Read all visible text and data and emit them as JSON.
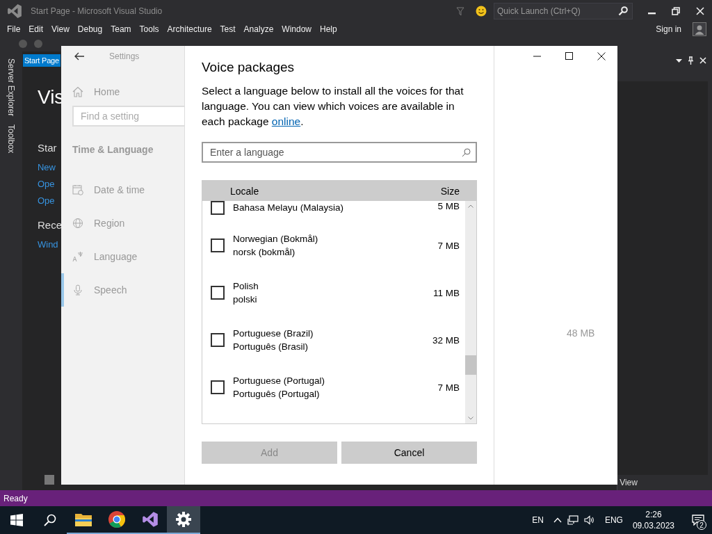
{
  "vs": {
    "title": "Start Page - Microsoft Visual Studio",
    "quick_launch": {
      "placeholder": "Quick Launch (Ctrl+Q)"
    },
    "menu": [
      "File",
      "Edit",
      "View",
      "Debug",
      "Team",
      "Tools",
      "Architecture",
      "Test",
      "Analyze",
      "Window",
      "Help"
    ],
    "sign_in": "Sign in",
    "side_tabs": [
      "Server Explorer",
      "Toolbox"
    ],
    "doc_tab": "Start Page",
    "start_page": {
      "heading": "Vis",
      "sections": [
        {
          "title": "Star",
          "links": [
            "New",
            "Ope",
            "Ope"
          ]
        },
        {
          "title": "Rece",
          "links": [
            "Wind"
          ]
        }
      ]
    },
    "panel_footer": "View",
    "status": "Ready"
  },
  "settings": {
    "title": "Settings",
    "home": "Home",
    "search": {
      "placeholder": "Find a setting"
    },
    "category": "Time & Language",
    "nav": [
      {
        "label": "Date & time",
        "kind": "calendar",
        "selected": false
      },
      {
        "label": "Region",
        "kind": "globe",
        "selected": false
      },
      {
        "label": "Language",
        "kind": "language",
        "selected": false
      },
      {
        "label": "Speech",
        "kind": "microphone",
        "selected": true
      }
    ],
    "background_size": "48 MB"
  },
  "dialog": {
    "title": "Voice packages",
    "description": "Select a language below to install all the voices for that language. You can view which voices are available in each package ",
    "link": "online",
    "after_link": ".",
    "search": {
      "placeholder": "Enter a language"
    },
    "columns": [
      "Locale",
      "Size"
    ],
    "rows": [
      {
        "name": "",
        "native": "Bahasa Melayu (Malaysia)",
        "size": "5 MB",
        "checked": false
      },
      {
        "name": "Norwegian (Bokmål)",
        "native": "norsk (bokmål)",
        "size": "7 MB",
        "checked": false
      },
      {
        "name": "Polish",
        "native": "polski",
        "size": "11 MB",
        "checked": false
      },
      {
        "name": "Portuguese (Brazil)",
        "native": "Português (Brasil)",
        "size": "32 MB",
        "checked": false
      },
      {
        "name": "Portuguese (Portugal)",
        "native": "Português (Portugal)",
        "size": "7 MB",
        "checked": false
      }
    ],
    "buttons": [
      {
        "label": "Add",
        "disabled": true
      },
      {
        "label": "Cancel",
        "disabled": false
      }
    ]
  },
  "taskbar": {
    "apps": [
      {
        "kind": "folder",
        "running": true,
        "selected": false
      },
      {
        "kind": "browser",
        "running": true,
        "selected": false
      },
      {
        "kind": "ide",
        "running": true,
        "selected": false
      },
      {
        "kind": "settings",
        "running": true,
        "selected": true
      }
    ],
    "input_short": "EN",
    "input_lang": "ENG",
    "time": "2:26",
    "date": "09.03.2023",
    "notifications": "2"
  }
}
